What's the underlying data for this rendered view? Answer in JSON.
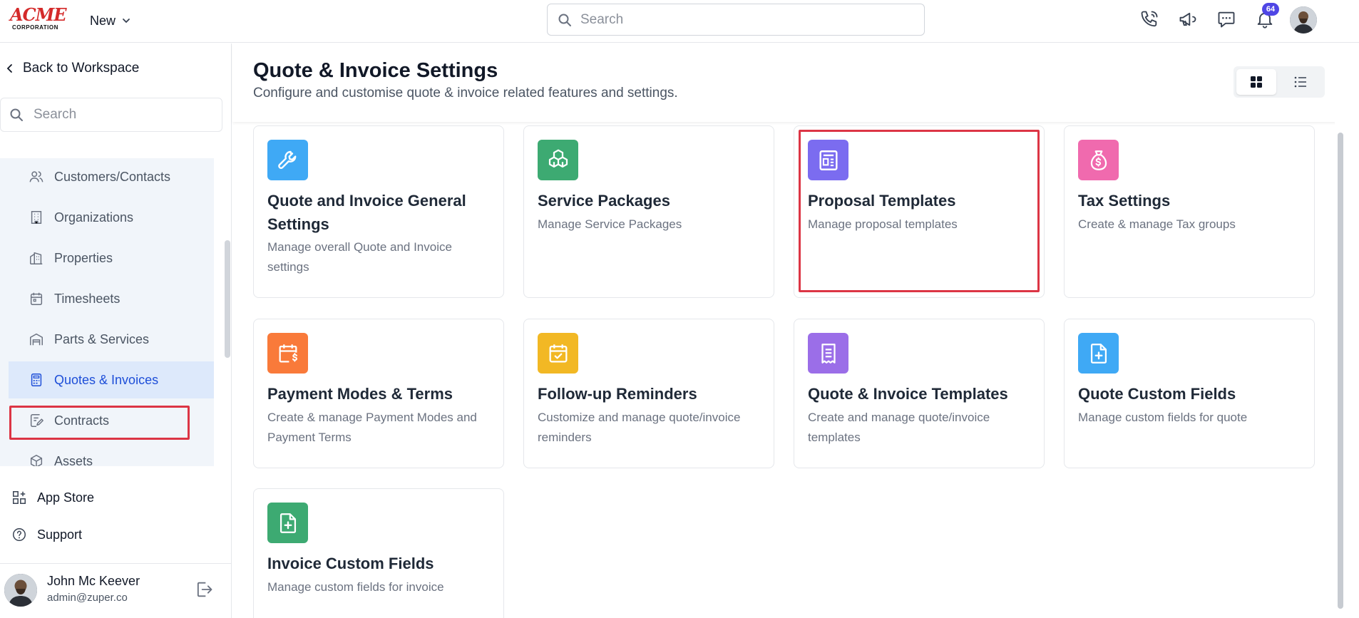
{
  "topbar": {
    "logo_text": "ACME",
    "logo_sub": "CORPORATION",
    "new_label": "New",
    "search_placeholder": "Search",
    "notification_count": "64",
    "icons": [
      "phone-icon",
      "megaphone-icon",
      "chat-icon",
      "bell-icon"
    ]
  },
  "sidebar": {
    "back_label": "Back to Workspace",
    "search_placeholder": "Search",
    "items": [
      {
        "label": "Customers/Contacts",
        "icon": "users-icon"
      },
      {
        "label": "Organizations",
        "icon": "building-icon"
      },
      {
        "label": "Properties",
        "icon": "properties-icon"
      },
      {
        "label": "Timesheets",
        "icon": "calendar-icon"
      },
      {
        "label": "Parts & Services",
        "icon": "warehouse-icon"
      },
      {
        "label": "Quotes & Invoices",
        "icon": "calculator-icon",
        "active": true
      },
      {
        "label": "Contracts",
        "icon": "contract-icon"
      },
      {
        "label": "Assets",
        "icon": "cube-icon"
      }
    ],
    "footer_items": [
      {
        "label": "App Store",
        "icon": "apps-icon"
      },
      {
        "label": "Support",
        "icon": "help-icon"
      }
    ],
    "user": {
      "name": "John Mc Keever",
      "email": "admin@zuper.co"
    }
  },
  "main": {
    "title": "Quote & Invoice Settings",
    "subtitle": "Configure and customise quote & invoice related features and settings.",
    "view_mode": "grid",
    "cards": [
      {
        "title": "Quote and Invoice General Settings",
        "description": "Manage overall Quote and Invoice settings",
        "icon": "wrench-icon",
        "color": "#3fa9f5"
      },
      {
        "title": "Service Packages",
        "description": "Manage Service Packages",
        "icon": "boxes-icon",
        "color": "#3daa72"
      },
      {
        "title": "Proposal Templates",
        "description": "Manage proposal templates",
        "icon": "template-icon",
        "color": "#7b6cf0",
        "highlighted": true
      },
      {
        "title": "Tax Settings",
        "description": "Create & manage Tax groups",
        "icon": "money-bag-icon",
        "color": "#f06aae"
      },
      {
        "title": "Payment Modes & Terms",
        "description": "Create & manage Payment Modes and Payment Terms",
        "icon": "calendar-dollar-icon",
        "color": "#f97a3a"
      },
      {
        "title": "Follow-up Reminders",
        "description": "Customize and manage quote/invoice reminders",
        "icon": "calendar-check-icon",
        "color": "#f2b824"
      },
      {
        "title": "Quote & Invoice Templates",
        "description": "Create and manage quote/invoice templates",
        "icon": "receipt-icon",
        "color": "#9b6ee8"
      },
      {
        "title": "Quote Custom Fields",
        "description": "Manage custom fields for quote",
        "icon": "file-plus-icon",
        "color": "#3fa9f5"
      },
      {
        "title": "Invoice Custom Fields",
        "description": "Manage custom fields for invoice",
        "icon": "file-plus-icon",
        "color": "#3daa72"
      }
    ]
  }
}
